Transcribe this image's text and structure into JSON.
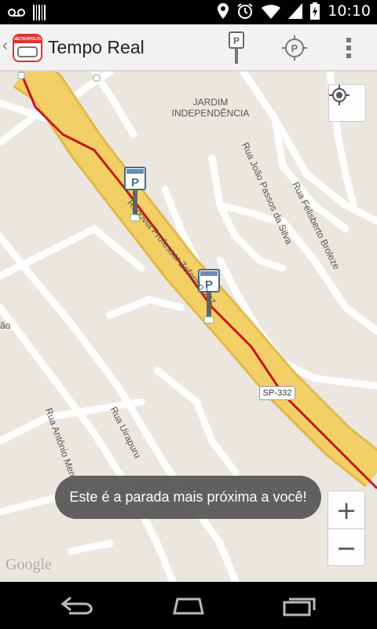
{
  "status_bar": {
    "time": "10:10",
    "icons": [
      "voicemail-icon",
      "barcode-icon",
      "location-icon",
      "alarm-icon",
      "wifi-icon",
      "signal-icon",
      "battery-charging-icon"
    ]
  },
  "action_bar": {
    "title": "Tempo Real",
    "logo_text": "METROPOLITANO",
    "actions": [
      "bus-stop-icon",
      "location-pin-icon",
      "overflow-menu-icon"
    ]
  },
  "map": {
    "labels": {
      "neighborhood": "JARDIM INDEPENDÊNCIA",
      "rua_joao": "Rua João Passos da Silva",
      "rua_felisberto": "Rua Felisberto Broleze",
      "rodovia": "Rodovia Professor Zeferino Vaz",
      "rua_uirapuru": "Rua Uirapuru",
      "rua_antonio": "Rua Antônio Men",
      "left_edge": "ão",
      "route_shield": "SP-332"
    },
    "google_logo": "Google",
    "zoom_in": "+",
    "zoom_out": "−"
  },
  "toast": {
    "message": "Este é a parada mais próxima a você!"
  },
  "nav_bar": {
    "buttons": [
      "back-icon",
      "home-icon",
      "recents-icon"
    ]
  },
  "colors": {
    "highway": "#f3d065",
    "route": "#c4171c",
    "map_bg": "#ebe7e0",
    "road": "#ffffff"
  }
}
